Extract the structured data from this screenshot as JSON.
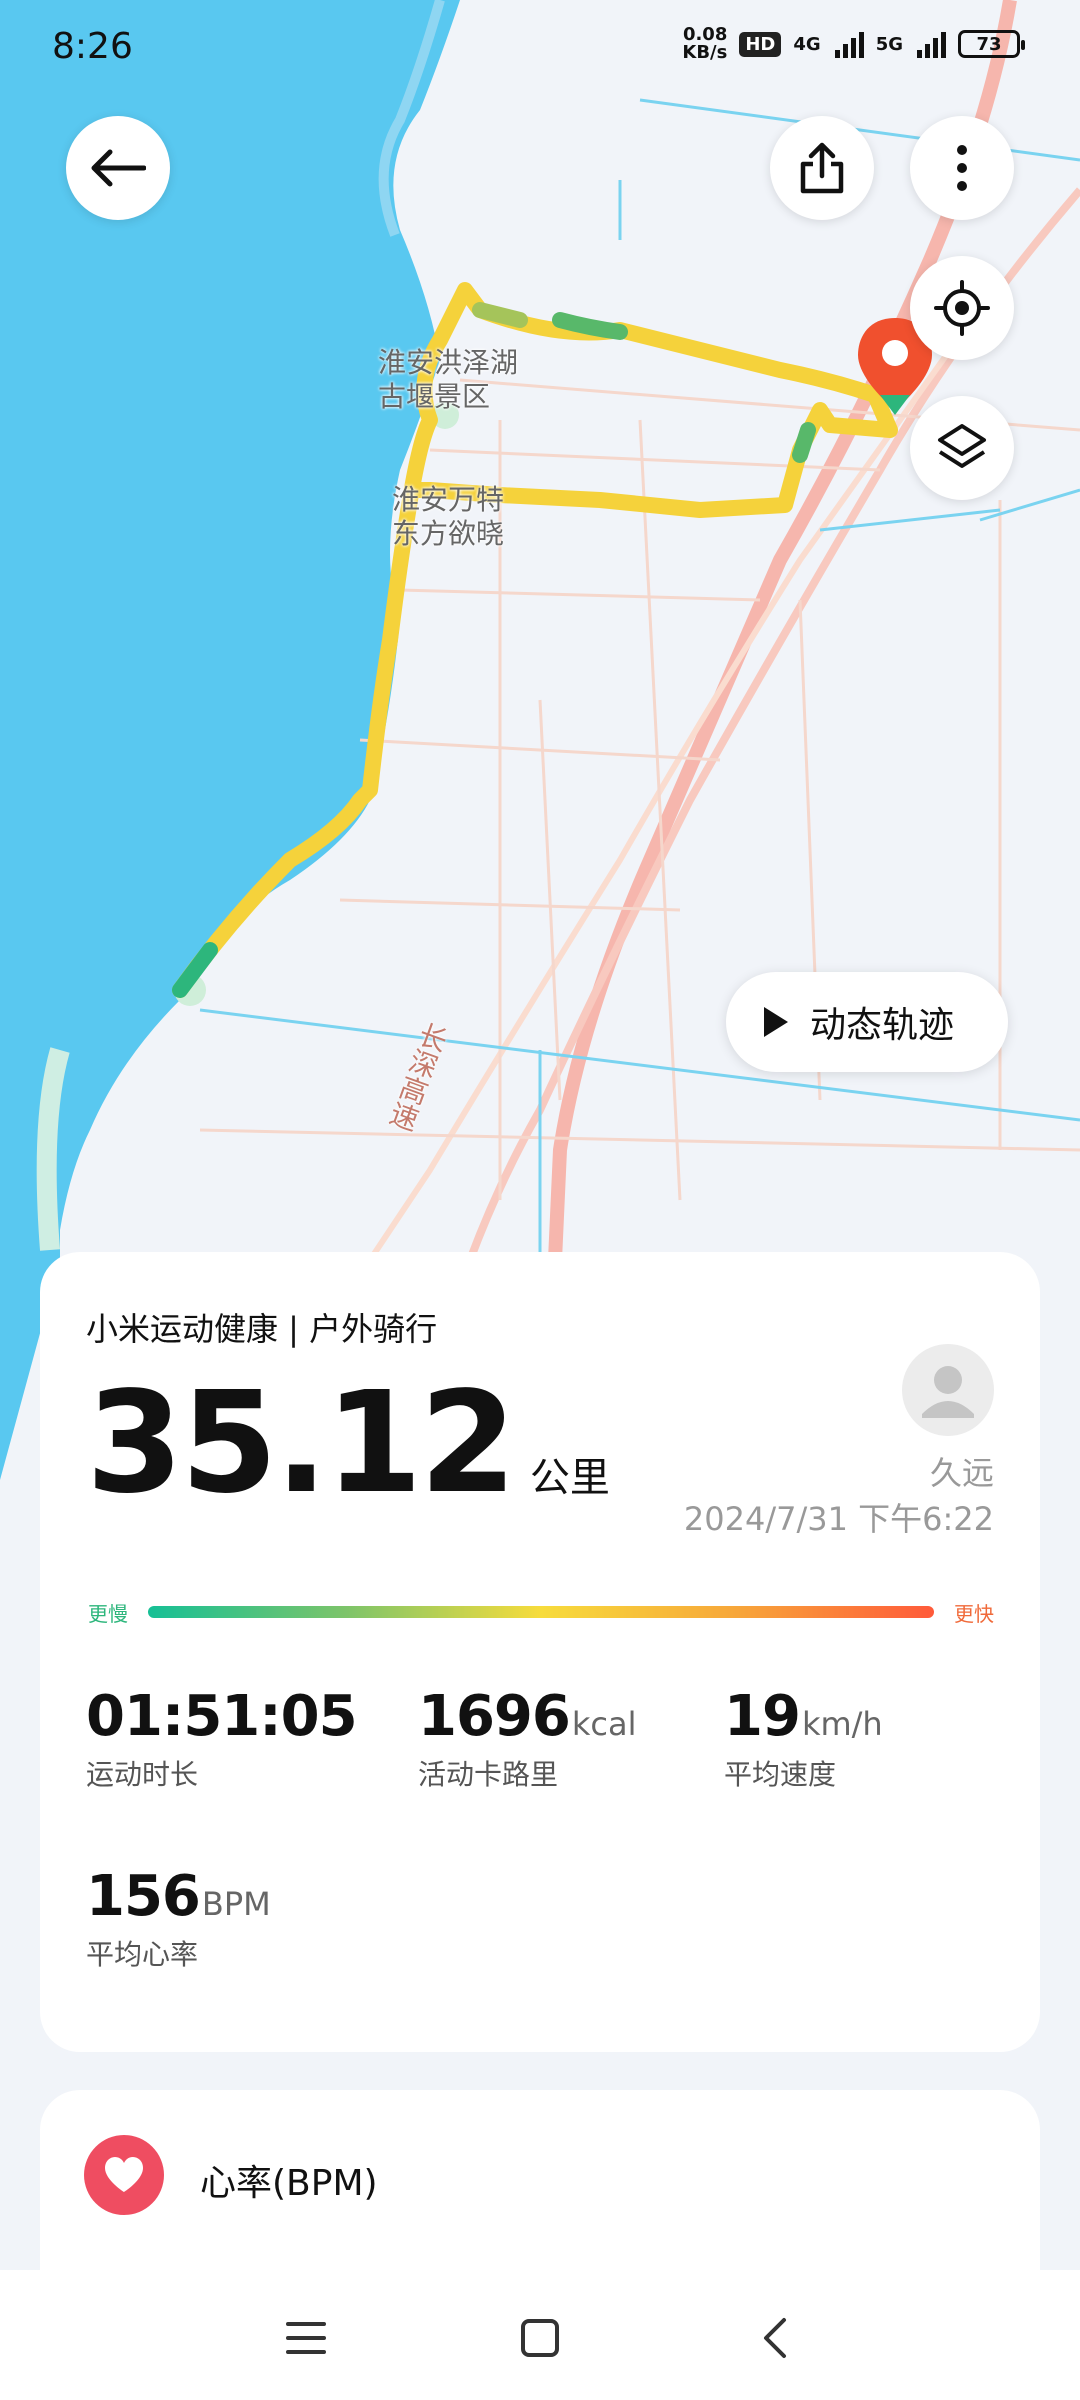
{
  "status_bar": {
    "time": "8:26",
    "net_speed_value": "0.08",
    "net_speed_unit": "KB/s",
    "hd_badge": "HD",
    "signal_1": "4G",
    "signal_2": "5G",
    "battery": "73"
  },
  "map": {
    "labels": {
      "scenic_area_line1": "淮安洪泽湖",
      "scenic_area_line2": "古堰景区",
      "poi_line1": "淮安万特",
      "poi_line2": "东方欲晓",
      "highway": "长深高速"
    },
    "route_color": "#f5d23b",
    "water_color": "#59c8f0"
  },
  "controls": {
    "back_icon": "arrow-left-icon",
    "share_icon": "share-icon",
    "more_icon": "more-vertical-icon",
    "locate_icon": "crosshair-icon",
    "layers_icon": "layers-icon",
    "replay_label": "动态轨迹"
  },
  "summary": {
    "title": "小米运动健康 | 户外骑行",
    "distance_value": "35.12",
    "distance_unit": "公里",
    "user_name": "久远",
    "date_time": "2024/7/31 下午6:22",
    "legend_slow": "更慢",
    "legend_fast": "更快",
    "stats": [
      {
        "value": "01:51:05",
        "unit": "",
        "label": "运动时长"
      },
      {
        "value": "1696",
        "unit": "kcal",
        "label": "活动卡路里"
      },
      {
        "value": "19",
        "unit": "km/h",
        "label": "平均速度"
      },
      {
        "value": "156",
        "unit": "BPM",
        "label": "平均心率"
      }
    ]
  },
  "heart_rate": {
    "label": "心率(BPM)",
    "icon": "heart-icon",
    "accent": "#ef4d61"
  },
  "nav_bar": {
    "menu_icon": "menu-icon",
    "home_icon": "home-icon",
    "back_icon": "back-chevron-icon"
  }
}
